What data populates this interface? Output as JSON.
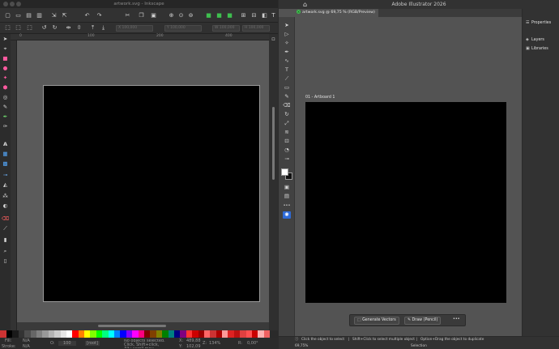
{
  "inkscape": {
    "title": "artwork.svg - Inkscape",
    "command_icons": [
      "new-document-icon",
      "open-icon",
      "save-icon",
      "print-icon",
      "import-icon",
      "export-icon",
      "undo-icon",
      "redo-icon",
      "cut-icon",
      "copy-icon",
      "paste-icon",
      "zoom-selection-icon",
      "zoom-drawing-icon",
      "zoom-page-icon",
      "duplicate-icon",
      "clone-icon",
      "unlink-clone-icon",
      "group-icon",
      "ungroup-icon",
      "fill-stroke-icon",
      "text-font-icon",
      "layers-icon",
      "align-icon"
    ],
    "controls": {
      "x_field": "X 100,000",
      "y_field": "Y 100,000",
      "w_field": "W 100,000",
      "h_field": "H 100,000"
    },
    "ruler_labels": [
      "0",
      "100",
      "200",
      "300",
      "400"
    ],
    "tools": [
      "selector-icon",
      "node-icon",
      "tweak-icon",
      "zoom-icon",
      "measure-icon",
      "rectangle-icon",
      "3d-box-icon",
      "ellipse-icon",
      "star-icon",
      "spiral-icon",
      "pencil-icon",
      "pen-icon",
      "calligraphy-icon",
      "text-icon",
      "gradient-icon",
      "mesh-icon",
      "dropper-icon",
      "paint-bucket-icon",
      "spray-icon",
      "eraser-icon",
      "connector-icon",
      "lpe-icon",
      "pages-icon"
    ],
    "palette": [
      "#000000",
      "#1a1a1a",
      "#333333",
      "#4d4d4d",
      "#666666",
      "#808080",
      "#999999",
      "#b3b3b3",
      "#cccccc",
      "#e6e6e6",
      "#ffffff",
      "#ff0000",
      "#ff8000",
      "#ffff00",
      "#80ff00",
      "#00ff00",
      "#00ff80",
      "#00ffff",
      "#0080ff",
      "#0000ff",
      "#8000ff",
      "#ff00ff",
      "#ff0080",
      "#800000",
      "#804000",
      "#808000",
      "#008000",
      "#008080",
      "#000080",
      "#800080",
      "#ff3333",
      "#cc0000",
      "#990000",
      "#ff6666",
      "#cc3333",
      "#aa0000",
      "#ff9999",
      "#dd2222",
      "#bb1111",
      "#e04040",
      "#ff5050",
      "#c80000",
      "#ffb0b0",
      "#f06060"
    ],
    "status": {
      "fill_label": "Fill:",
      "fill_value": "N/A",
      "stroke_label": "Stroke:",
      "stroke_value": "N/A",
      "opacity_label": "O:",
      "opacity_value": "100",
      "layer": "[root]",
      "message": "No objects selected. Click, Shift+click, Alt+scroll mou...",
      "x_label": "X:",
      "x_value": "489,88",
      "y_label": "Y:",
      "y_value": "102,09",
      "zoom_label": "Z:",
      "zoom_value": "134%",
      "rotation_label": "R:",
      "rotation_value": "0,00°"
    }
  },
  "illustrator": {
    "title": "Adobe Illustrator 2026",
    "tab_label": "artwork.svg @ 69,75 % (RGB/Preview)",
    "artboard_label": "01 - Artboard 1",
    "tools": [
      "selection-icon",
      "direct-selection-icon",
      "magic-wand-icon",
      "pen-icon",
      "curvature-icon",
      "text-icon",
      "line-icon",
      "rectangle-icon",
      "paintbrush-icon",
      "shaper-icon",
      "pencil-icon",
      "eraser-icon",
      "rotate-icon",
      "scale-icon",
      "width-icon",
      "free-transform-icon",
      "shape-builder-icon",
      "perspective-icon",
      "mesh-icon",
      "gradient-icon",
      "eyedropper-icon",
      "blend-icon",
      "symbol-sprayer-icon",
      "graph-icon",
      "artboard-icon",
      "slice-icon",
      "hand-icon",
      "zoom-icon"
    ],
    "panels": [
      {
        "label": "Properties",
        "icon": "properties-icon"
      },
      {
        "label": "Layers",
        "icon": "layers-icon"
      },
      {
        "label": "Libraries",
        "icon": "libraries-icon"
      }
    ],
    "context_bar": {
      "generate_vectors": "Generate Vectors",
      "draw_pencil": "Draw (Pencil)",
      "more": "•••"
    },
    "status": {
      "zoom": "69,75%",
      "tool": "Selection",
      "hint_1": "Click the object to select",
      "hint_2": "Shift+Click to select multiple object",
      "hint_3": "Option+Drag the object to duplicate"
    }
  }
}
